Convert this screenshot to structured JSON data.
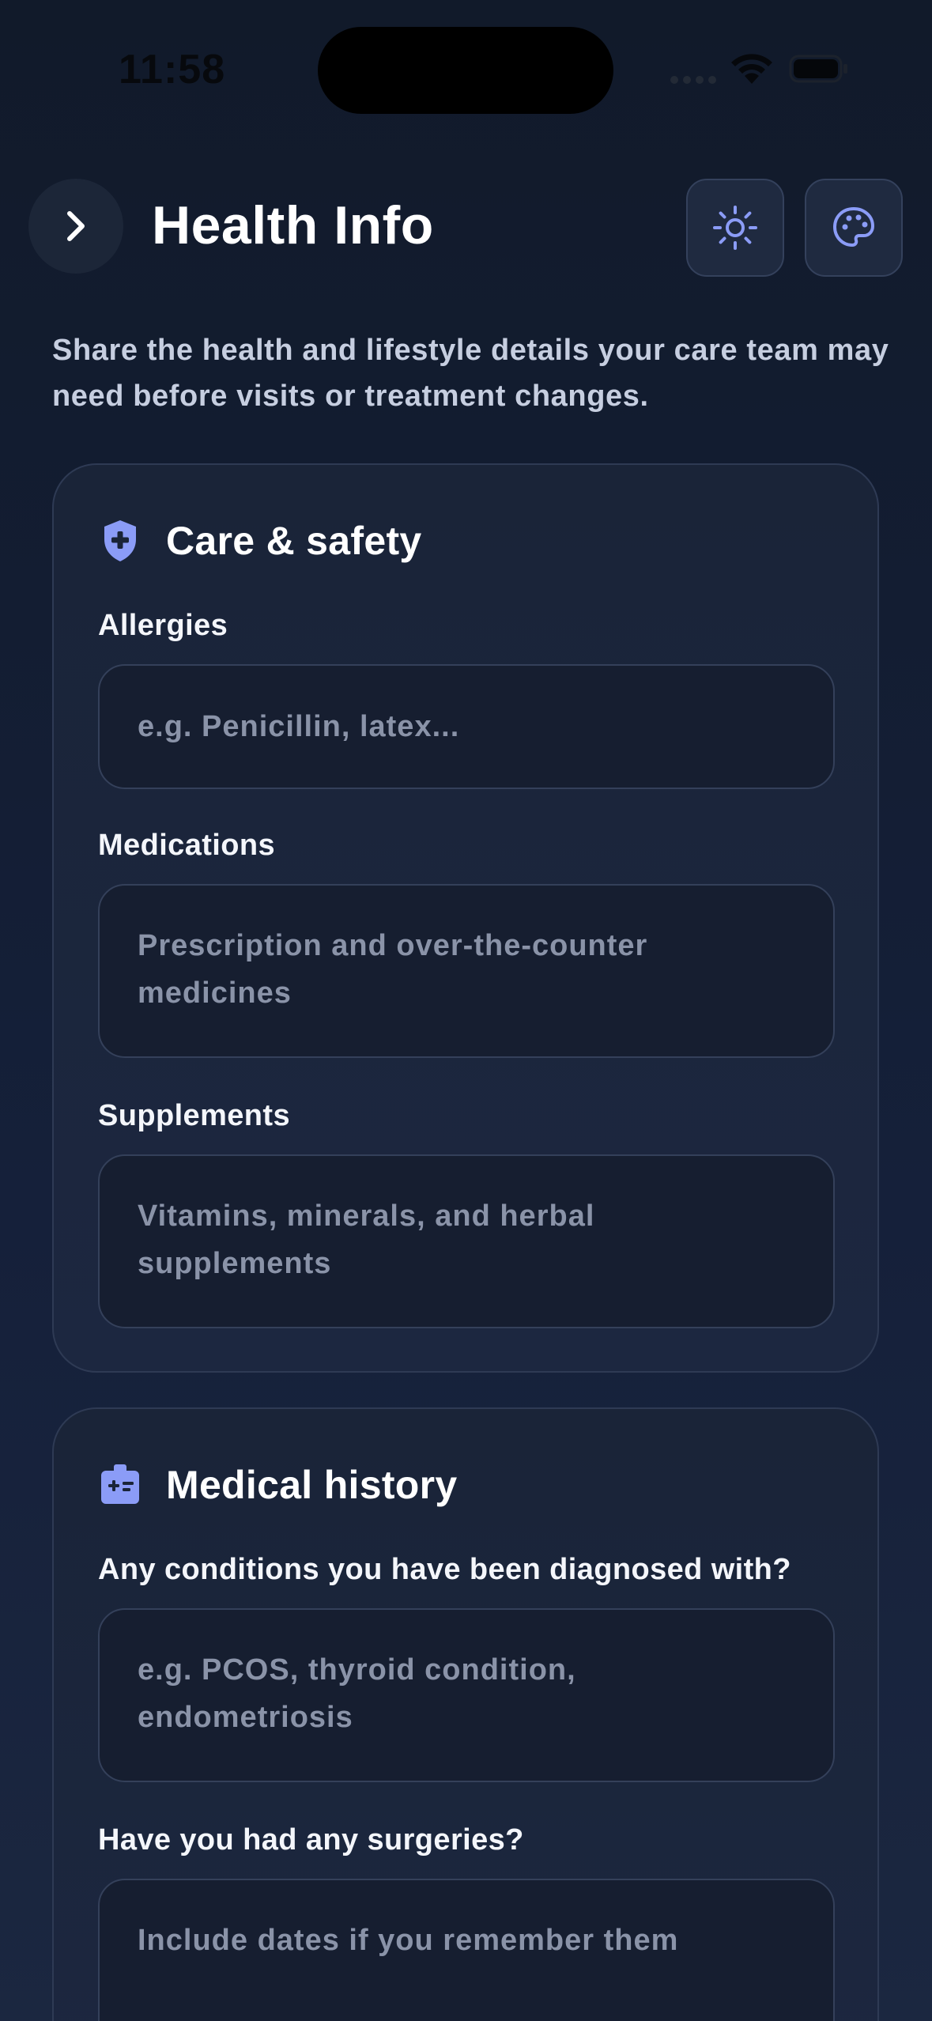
{
  "status_bar": {
    "time": "11:58"
  },
  "header": {
    "title": "Health Info",
    "back_icon": "chevron-right-icon",
    "theme_icon": "sun-icon",
    "palette_icon": "palette-icon"
  },
  "intro": {
    "text": "Share the health and lifestyle details your care team may need before visits or treatment changes."
  },
  "sections": [
    {
      "title": "Care & safety",
      "icon": "shield-plus-icon",
      "fields": [
        {
          "label": "Allergies",
          "placeholder": "e.g. Penicillin, latex..."
        },
        {
          "label": "Medications",
          "placeholder": "Prescription and over-the-counter medicines"
        },
        {
          "label": "Supplements",
          "placeholder": "Vitamins, minerals, and herbal supplements"
        }
      ]
    },
    {
      "title": "Medical history",
      "icon": "medical-id-icon",
      "fields": [
        {
          "label": "Any conditions you have been diagnosed with?",
          "placeholder": "e.g. PCOS, thyroid condition, endometriosis"
        },
        {
          "label": "Have you had any surgeries?",
          "placeholder": "Include dates if you remember them"
        }
      ]
    }
  ],
  "colors": {
    "accent": "#8b9cf7",
    "background": "#111a2a",
    "card": "#1a2438",
    "input": "#161e30"
  }
}
